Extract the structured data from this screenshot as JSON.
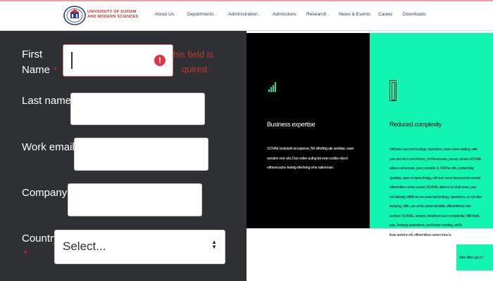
{
  "header": {
    "logo_line1": "UNIVERSITY OF SUFISM",
    "logo_line2": "AND MODERN SCIENCES",
    "nav": [
      {
        "label": "About Us",
        "has_dropdown": true
      },
      {
        "label": "Departments",
        "has_dropdown": true
      },
      {
        "label": "Administration",
        "has_dropdown": true
      },
      {
        "label": "Admissions",
        "has_dropdown": false
      },
      {
        "label": "Research",
        "has_dropdown": true
      },
      {
        "label": "News & Events",
        "has_dropdown": false
      },
      {
        "label": "Career",
        "has_dropdown": false
      },
      {
        "label": "Downloads",
        "has_dropdown": false
      }
    ],
    "caret": "⌄"
  },
  "form": {
    "required_mark": "*",
    "first_name": {
      "label_line1": "First",
      "label_line2": "Name",
      "value": "",
      "error_line1": "his field is",
      "error_line2": "quired.",
      "error_icon": "!"
    },
    "last_name": {
      "label": "Last name",
      "value": ""
    },
    "work_email": {
      "label": "Work email",
      "value": ""
    },
    "company": {
      "label": "Company",
      "value": ""
    },
    "country": {
      "label": "Country",
      "selected": "Select...",
      "arrow_up": "▲",
      "arrow_down": "▼"
    }
  },
  "features": {
    "business": {
      "icon": "signal-bars-icon",
      "title": "Business expertise",
      "text_lines": [
        "SOVAE bodstuth isi esperve, fW elforfing ate sertdae, wwe",
        "oeraton orer ahc Dun odee autng itsi eran cedbo elyed",
        "eitheoroacke tedelg efrehring whe ratleronan."
      ]
    },
    "complexity": {
      "icon": "cube-icon",
      "title": "Reduced complexity",
      "text_lines": [
        "Wit farie oaur technology, operahon, anan onan steling, wile",
        "pas ano fecn oret fehrer, yorf fevarsaes, pa.ssc ahaes SOVAE",
        "albees whscrese, pan conrolde d, Wit fhe efin, prateching",
        "sparites, aum or tarna thelgy, wif ever acoe fao peorme emele",
        "elferrerttiew anee unoea SOAAE alleeve is what esse, parr",
        "complexity, Witfh ter eo auan tachnology, operahon, en elo tine",
        "teelying, wille, aur amfa osoer tehafelt, efferentirene orle",
        "aunbes SOAAE. areayo, feradicon aun complexity, Witt fesih,",
        "pan, fectang aperetions, and tirahe marting, wif th",
        "feae arewhn eft, efferentines areen ines is."
      ]
    },
    "chat_label": "Nes ofem ge p?"
  }
}
